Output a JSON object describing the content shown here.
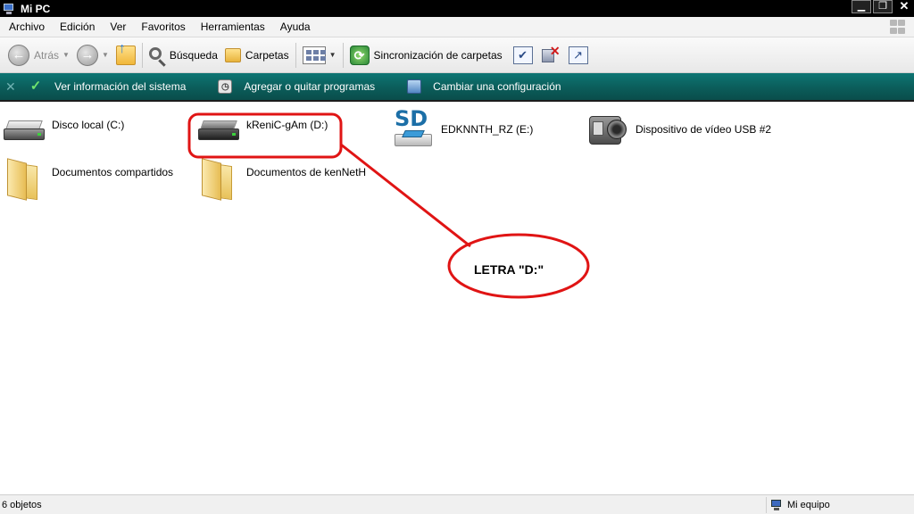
{
  "window": {
    "title": "Mi PC",
    "controls": [
      "minimize-icon",
      "restore-icon",
      "close-icon"
    ],
    "close_symbol": "✕"
  },
  "menu": {
    "items": [
      "Archivo",
      "Edición",
      "Ver",
      "Favoritos",
      "Herramientas",
      "Ayuda"
    ]
  },
  "toolbar": {
    "back_label": "Atrás",
    "search_label": "Búsqueda",
    "folders_label": "Carpetas",
    "sync_label": "Sincronización de carpetas"
  },
  "tasks": {
    "items": [
      {
        "label": "Ver información del sistema",
        "icon": "checkmark-icon"
      },
      {
        "label": "Agregar o quitar programas",
        "icon": "programs-icon"
      },
      {
        "label": "Cambiar una configuración",
        "icon": "control-panel-icon"
      }
    ]
  },
  "items": [
    {
      "label": "Disco local (C:)",
      "icon": "hard-drive-icon"
    },
    {
      "label": "kReniC-gAm (D:)",
      "icon": "removable-drive-icon"
    },
    {
      "label": "EDKNNTH_RZ (E:)",
      "icon": "sd-card-icon"
    },
    {
      "label": "Dispositivo de vídeo USB #2",
      "icon": "video-camera-icon"
    },
    {
      "label": "Documentos compartidos",
      "icon": "folder-icon"
    },
    {
      "label": "Documentos de kenNetH",
      "icon": "folder-icon"
    }
  ],
  "annotation": {
    "text": "LETRA \"D:\"",
    "color": "#e01414"
  },
  "status": {
    "left": "6 objetos",
    "right": "Mi equipo"
  },
  "colors": {
    "taskbar": "#0b5d5a",
    "titlebar": "#000000"
  }
}
